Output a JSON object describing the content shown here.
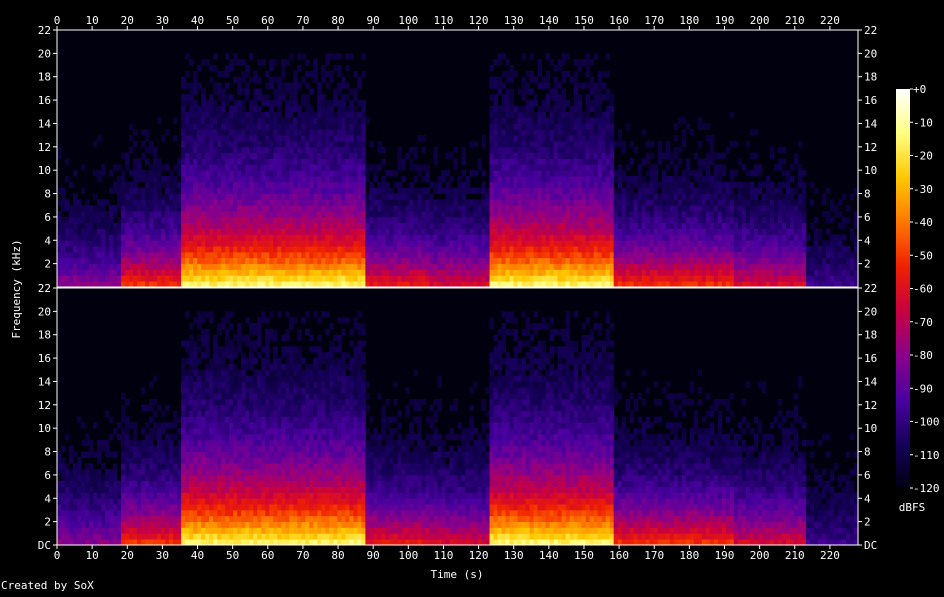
{
  "chart_data": {
    "type": "heatmap",
    "title": "",
    "xlabel": "Time (s)",
    "ylabel": "Frequency (kHz)",
    "credit": "Created by SoX",
    "xlim": [
      0,
      228
    ],
    "ylim": [
      0,
      22
    ],
    "x_ticks": [
      "0",
      "10",
      "20",
      "30",
      "40",
      "50",
      "60",
      "70",
      "80",
      "90",
      "100",
      "110",
      "120",
      "130",
      "140",
      "150",
      "160",
      "170",
      "180",
      "190",
      "200",
      "210",
      "220"
    ],
    "y_ticks_top_channel": [
      "2",
      "4",
      "6",
      "8",
      "10",
      "12",
      "14",
      "16",
      "18",
      "20",
      "22"
    ],
    "y_ticks_bottom_channel": [
      "DC",
      "2",
      "4",
      "6",
      "8",
      "10",
      "12",
      "14",
      "16",
      "18",
      "20",
      "22"
    ],
    "y_ticks_right_top_channel": [
      "2",
      "4",
      "6",
      "8",
      "10",
      "12",
      "14",
      "16",
      "18",
      "20",
      "22"
    ],
    "y_ticks_right_bottom_channel": [
      "DC",
      "2",
      "4",
      "6",
      "8",
      "10",
      "12",
      "14",
      "16",
      "18",
      "20",
      "22"
    ],
    "colorbar": {
      "unit": "dBFS",
      "ticks": [
        "+0",
        "-10",
        "-20",
        "-30",
        "-40",
        "-50",
        "-60",
        "-70",
        "-80",
        "-90",
        "-100",
        "-110",
        "-120"
      ],
      "stops": [
        "#000012",
        "#16005a",
        "#4a00a0",
        "#8a008a",
        "#c80040",
        "#f02000",
        "#ff7800",
        "#ffc800",
        "#ffff80",
        "#ffffff"
      ]
    },
    "channels": 2,
    "segments": [
      {
        "t0": 0,
        "t1": 18,
        "level": 0.35
      },
      {
        "t0": 18,
        "t1": 35,
        "level": 0.6
      },
      {
        "t0": 35,
        "t1": 88,
        "level": 0.9
      },
      {
        "t0": 88,
        "t1": 106,
        "level": 0.55
      },
      {
        "t0": 106,
        "t1": 123,
        "level": 0.5
      },
      {
        "t0": 123,
        "t1": 158,
        "level": 0.9
      },
      {
        "t0": 158,
        "t1": 193,
        "level": 0.6
      },
      {
        "t0": 193,
        "t1": 213,
        "level": 0.5
      },
      {
        "t0": 213,
        "t1": 228,
        "level": 0.2
      }
    ]
  }
}
